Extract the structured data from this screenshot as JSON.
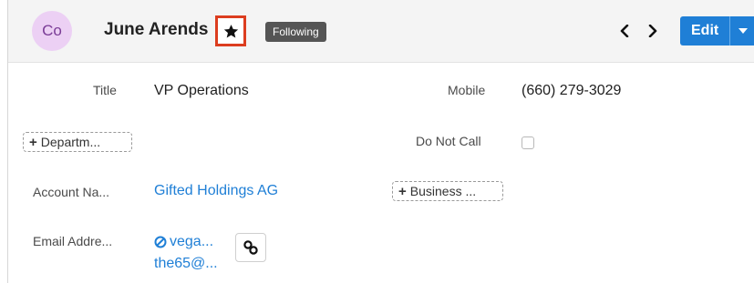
{
  "header": {
    "avatar_initials": "Co",
    "record_name": "June Arends",
    "follow_badge": "Following",
    "edit_label": "Edit",
    "icons": {
      "favorite": "star-icon",
      "prev": "chevron-left-icon",
      "next": "chevron-right-icon",
      "caret": "caret-down-icon",
      "link": "link-icon"
    }
  },
  "fields": {
    "title": {
      "label": "Title",
      "value": "VP Operations"
    },
    "mobile": {
      "label": "Mobile",
      "value": "(660) 279-3029"
    },
    "department_add": "Departm...",
    "do_not_call": {
      "label": "Do Not Call",
      "checked": false
    },
    "account": {
      "label": "Account Na...",
      "value": "Gifted Holdings AG"
    },
    "business_add": "Business ...",
    "email": {
      "label": "Email Addre...",
      "value_line1": "vega...",
      "value_line2": "the65@..."
    }
  },
  "colors": {
    "accent": "#1f7fd6",
    "highlight_border": "#dc3d1f",
    "avatar_bg": "#ecd0f4",
    "badge_bg": "#555555"
  }
}
